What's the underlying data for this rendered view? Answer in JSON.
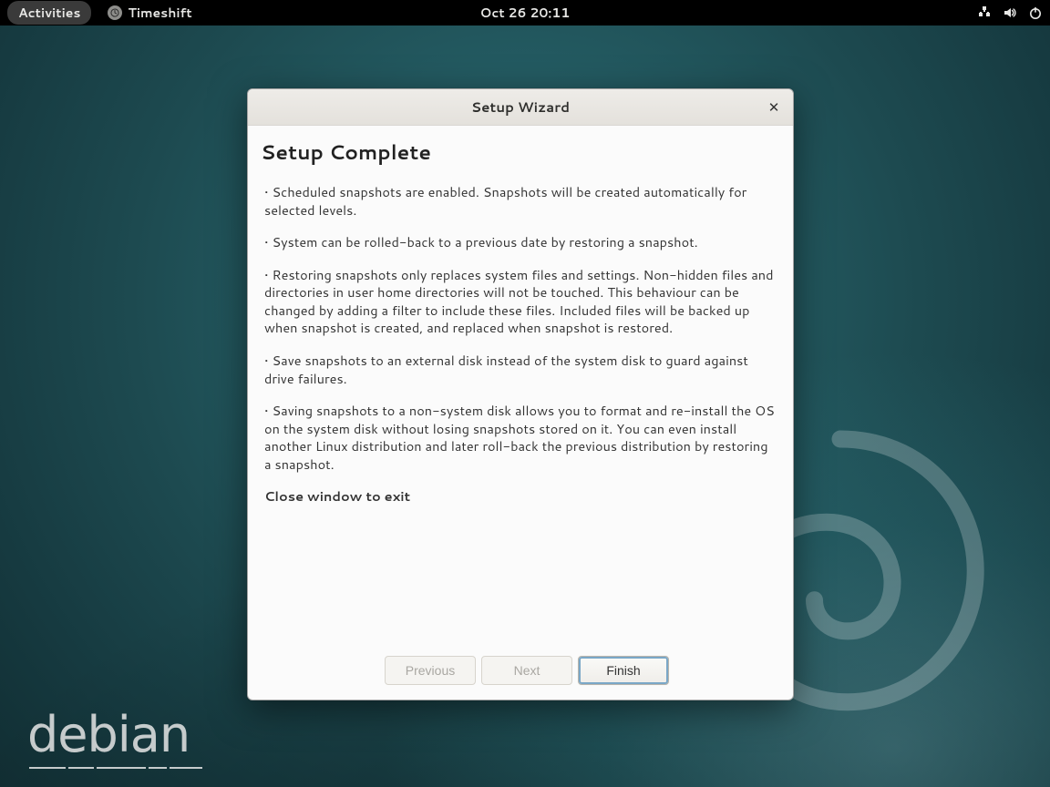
{
  "topbar": {
    "activities_label": "Activities",
    "app_name": "Timeshift",
    "app_icon_name": "timeshift-icon",
    "clock": "Oct 26  20:11"
  },
  "tray": {
    "network_icon": "network-wired-icon",
    "volume_icon": "audio-volume-high-icon",
    "power_icon": "system-shutdown-icon"
  },
  "branding": {
    "distro_name": "debian"
  },
  "dialog": {
    "window_title": "Setup Wizard",
    "close_tooltip": "Close",
    "heading": "Setup Complete",
    "bullets": [
      "• Scheduled snapshots are enabled. Snapshots will be created automatically for selected levels.",
      "• System can be rolled-back to a previous date by restoring a snapshot.",
      "• Restoring snapshots only replaces system files and settings. Non-hidden files and directories in user home directories will not be touched. This behaviour can be changed by adding a filter to include these files. Included files will be backed up when snapshot is created, and replaced when snapshot is restored.",
      "• Save snapshots to an external disk instead of the system disk to guard against drive failures.",
      "• Saving snapshots to a non-system disk allows you to format and re-install the OS on the system disk without losing snapshots stored on it. You can even install another Linux distribution and later roll-back the previous distribution by restoring a snapshot."
    ],
    "exit_hint": "Close window to exit",
    "buttons": {
      "previous": "Previous",
      "next": "Next",
      "finish": "Finish"
    }
  }
}
